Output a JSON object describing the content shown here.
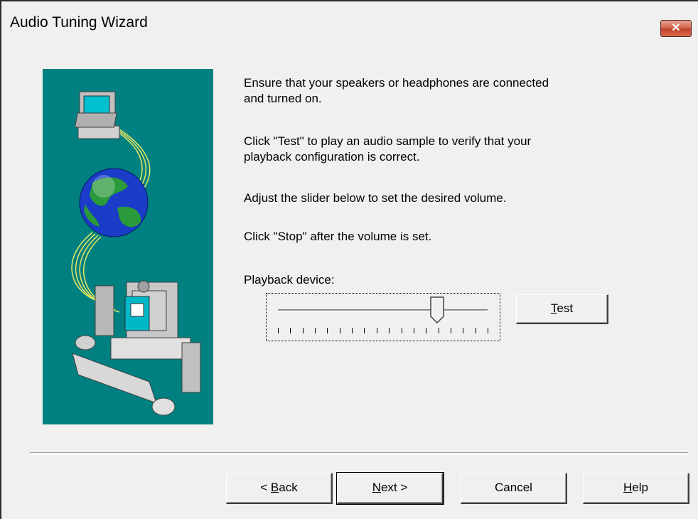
{
  "window": {
    "title": "Audio Tuning Wizard",
    "close_label": "✕"
  },
  "instructions": [
    "Ensure that your speakers or headphones are connected",
    "and turned on.",
    "Click \"Test\" to play an audio sample to verify that your",
    "playback configuration is correct.",
    "Adjust the slider below to set the desired volume.",
    "Click \"Stop\" after the volume is set."
  ],
  "playback": {
    "label": "Playback device:",
    "volume_fraction": 0.76,
    "tick_count": 18
  },
  "buttons": {
    "test": {
      "mnemonic": "T",
      "rest": "est"
    },
    "back": {
      "prefix": "< ",
      "mnemonic": "B",
      "rest": "ack"
    },
    "next": {
      "mnemonic": "N",
      "rest": "ext >"
    },
    "cancel": "Cancel",
    "help": {
      "mnemonic": "H",
      "rest": "elp"
    }
  },
  "illustration": {
    "icons": [
      "computer-icon",
      "globe-icon",
      "multimedia-computer-icon"
    ],
    "background_color": "#008080"
  }
}
